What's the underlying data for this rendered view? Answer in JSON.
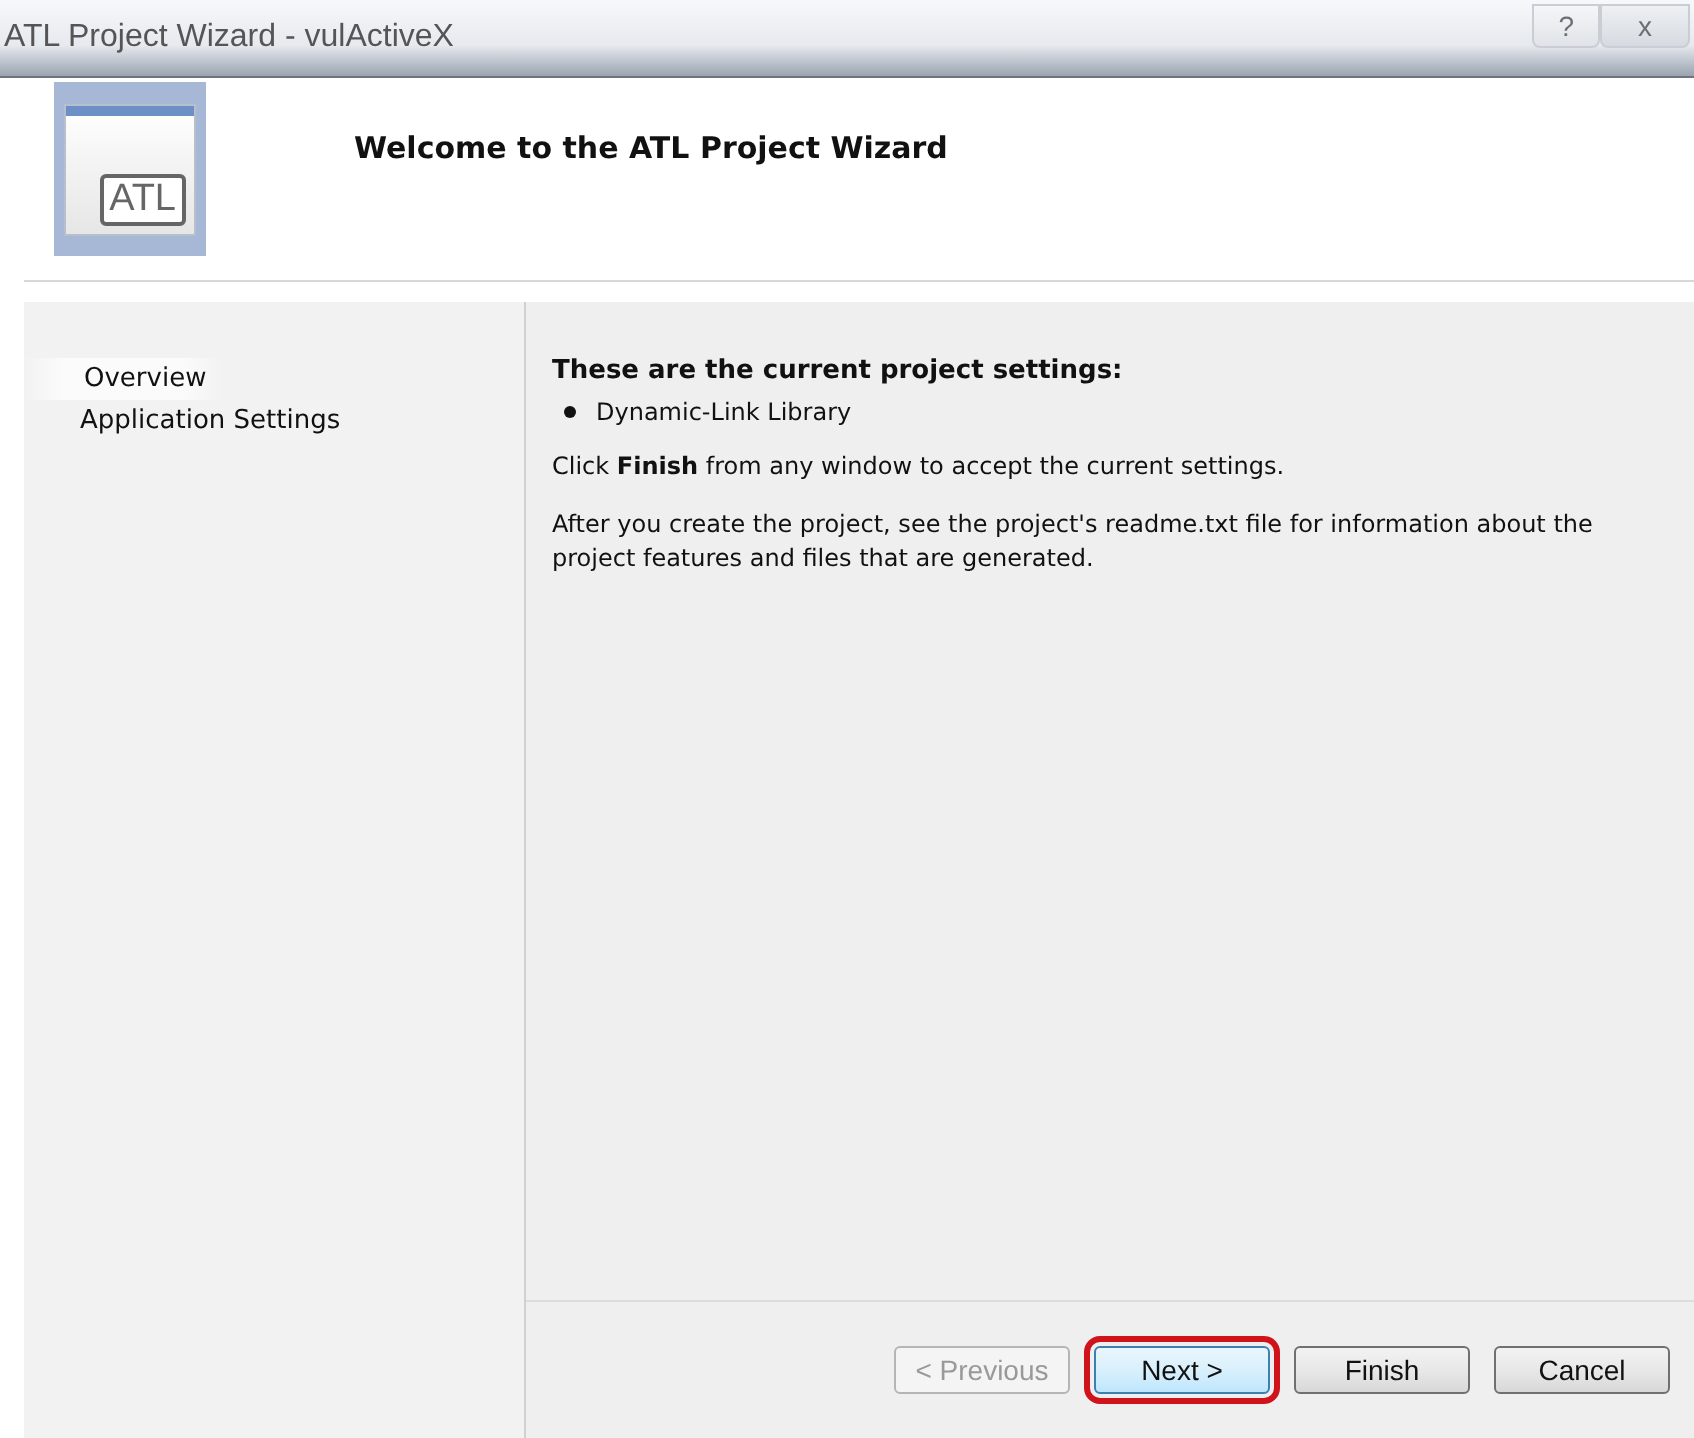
{
  "window": {
    "title": "ATL Project Wizard - vulActiveX",
    "title_buttons": [
      {
        "kind": "help",
        "label": "?"
      },
      {
        "kind": "close",
        "label": "x"
      }
    ]
  },
  "header": {
    "title": "Welcome to the ATL Project Wizard",
    "logo_text": "ATL"
  },
  "sidebar": {
    "items": [
      {
        "label": "Overview",
        "selected": true
      },
      {
        "label": "Application Settings",
        "selected": false
      }
    ]
  },
  "content": {
    "heading": "These are the current project settings:",
    "bullets": [
      "Dynamic-Link Library"
    ],
    "paragraphs": [
      "Click **Finish** from any window to accept the current settings.",
      "After you create the project, see the project's readme.txt file for information about the project features and files that are generated."
    ]
  },
  "buttons": [
    {
      "label": "< Previous",
      "disabled": true,
      "highlighted": false
    },
    {
      "label": "Next >",
      "disabled": false,
      "highlighted": true
    },
    {
      "label": "Finish",
      "disabled": false,
      "highlighted": false
    },
    {
      "label": "Cancel",
      "disabled": false,
      "highlighted": false
    }
  ]
}
